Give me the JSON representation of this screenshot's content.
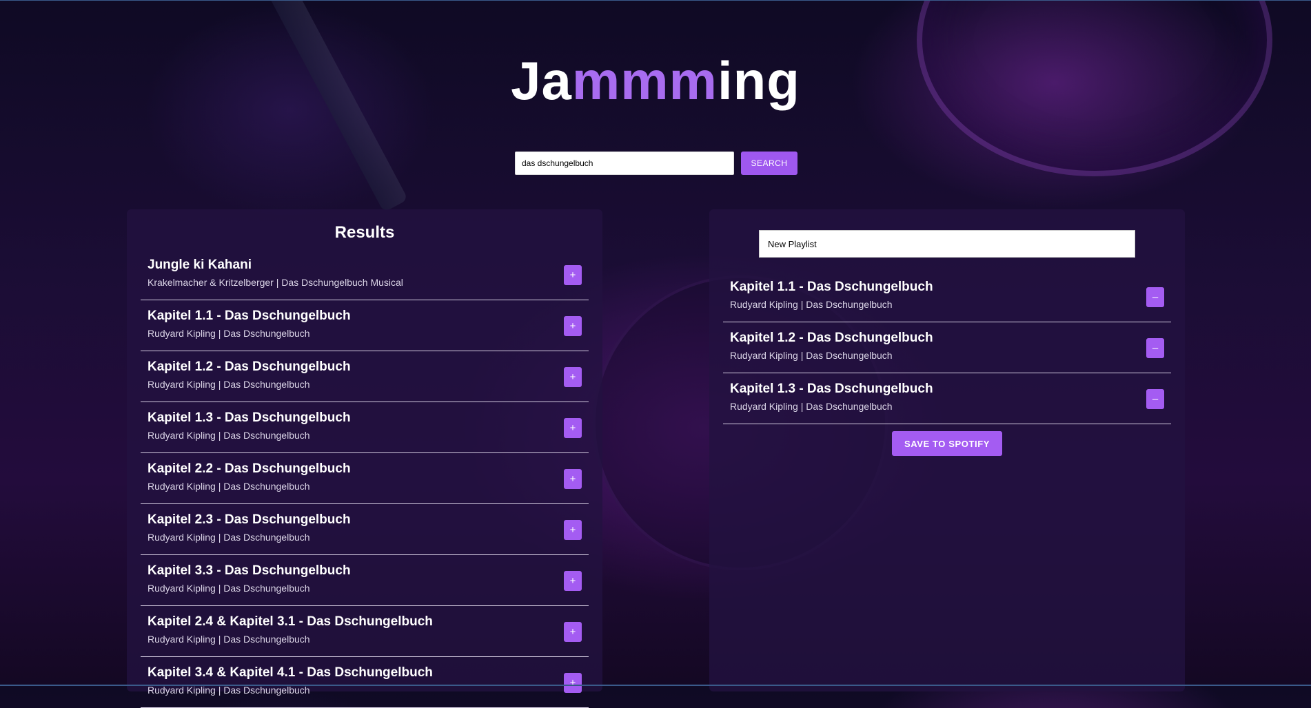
{
  "app": {
    "title_parts": [
      "Ja",
      "mmm",
      "ing"
    ],
    "accent_color": "#a86cf0",
    "button_color": "#9f58ef"
  },
  "search": {
    "value": "das dschungelbuch",
    "button_label": "SEARCH"
  },
  "results": {
    "title": "Results",
    "tracks": [
      {
        "name": "Jungle ki Kahani",
        "meta": "Krakelmacher & Kritzelberger | Das Dschungelbuch Musical",
        "action": "+"
      },
      {
        "name": "Kapitel 1.1 - Das Dschungelbuch",
        "meta": "Rudyard Kipling | Das Dschungelbuch",
        "action": "+"
      },
      {
        "name": "Kapitel 1.2 - Das Dschungelbuch",
        "meta": "Rudyard Kipling | Das Dschungelbuch",
        "action": "+"
      },
      {
        "name": "Kapitel 1.3 - Das Dschungelbuch",
        "meta": "Rudyard Kipling | Das Dschungelbuch",
        "action": "+"
      },
      {
        "name": "Kapitel 2.2 - Das Dschungelbuch",
        "meta": "Rudyard Kipling | Das Dschungelbuch",
        "action": "+"
      },
      {
        "name": "Kapitel 2.3 - Das Dschungelbuch",
        "meta": "Rudyard Kipling | Das Dschungelbuch",
        "action": "+"
      },
      {
        "name": "Kapitel 3.3 - Das Dschungelbuch",
        "meta": "Rudyard Kipling | Das Dschungelbuch",
        "action": "+"
      },
      {
        "name": "Kapitel 2.4 & Kapitel 3.1 - Das Dschungelbuch",
        "meta": "Rudyard Kipling | Das Dschungelbuch",
        "action": "+"
      },
      {
        "name": "Kapitel 3.4 & Kapitel 4.1 - Das Dschungelbuch",
        "meta": "Rudyard Kipling | Das Dschungelbuch",
        "action": "+"
      }
    ]
  },
  "playlist": {
    "name": "New Playlist",
    "tracks": [
      {
        "name": "Kapitel 1.1 - Das Dschungelbuch",
        "meta": "Rudyard Kipling | Das Dschungelbuch",
        "action": "–"
      },
      {
        "name": "Kapitel 1.2 - Das Dschungelbuch",
        "meta": "Rudyard Kipling | Das Dschungelbuch",
        "action": "–"
      },
      {
        "name": "Kapitel 1.3 - Das Dschungelbuch",
        "meta": "Rudyard Kipling | Das Dschungelbuch",
        "action": "–"
      }
    ],
    "save_label": "SAVE TO SPOTIFY"
  }
}
